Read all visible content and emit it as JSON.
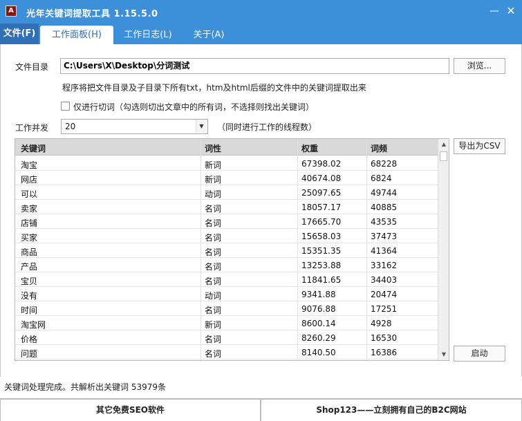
{
  "window": {
    "title": "光年关键词提取工具 1.15.5.0",
    "icon_name": "app-icon",
    "icon_glyph": "A",
    "minimize_glyph": "—",
    "close_glyph": "✕"
  },
  "tabs": [
    {
      "label": "文件(F)"
    },
    {
      "label": "工作面板(H)"
    },
    {
      "label": "工作日志(L)"
    },
    {
      "label": "关于(A)"
    }
  ],
  "form": {
    "dir_label": "文件目录",
    "dir_value": "C:\\Users\\X\\Desktop\\分词测试",
    "browse_label": "浏览...",
    "hint": "程序将把文件目录及子目录下所有txt，htm及html后缀的文件中的关键词提取出来",
    "split_only_label": "仅进行切词（勾选则切出文章中的所有词，不选择则找出关键词）",
    "concurrency_label": "工作并发",
    "concurrency_value": "20",
    "concurrency_hint": "（同时进行工作的线程数）",
    "export_label": "导出为CSV",
    "start_label": "启动"
  },
  "table": {
    "columns": [
      "关键词",
      "词性",
      "权重",
      "词频"
    ],
    "rows": [
      [
        "淘宝",
        "新词",
        "67398.02",
        "68228"
      ],
      [
        "网店",
        "新词",
        "40674.08",
        "6824"
      ],
      [
        "可以",
        "动词",
        "25097.65",
        "49744"
      ],
      [
        "卖家",
        "名词",
        "18057.17",
        "40885"
      ],
      [
        "店铺",
        "名词",
        "17665.70",
        "43535"
      ],
      [
        "买家",
        "名词",
        "15658.03",
        "37473"
      ],
      [
        "商品",
        "名词",
        "15351.35",
        "41364"
      ],
      [
        "产品",
        "名词",
        "13253.88",
        "33162"
      ],
      [
        "宝贝",
        "名词",
        "11841.65",
        "34403"
      ],
      [
        "没有",
        "动词",
        "9341.88",
        "20474"
      ],
      [
        "时间",
        "名词",
        "9076.88",
        "17251"
      ],
      [
        "淘宝网",
        "新词",
        "8600.14",
        "4928"
      ],
      [
        "价格",
        "名词",
        "8260.29",
        "16530"
      ],
      [
        "问题",
        "名词",
        "8140.50",
        "16386"
      ]
    ]
  },
  "status": "关键词处理完成。共解析出关键词 53979条",
  "footer": {
    "left": "其它免费SEO软件",
    "right": "Shop123——立刻拥有自己的B2C网站"
  },
  "colors": {
    "accent": "#3c8fd9",
    "file_tab": "#2f6fb5"
  }
}
